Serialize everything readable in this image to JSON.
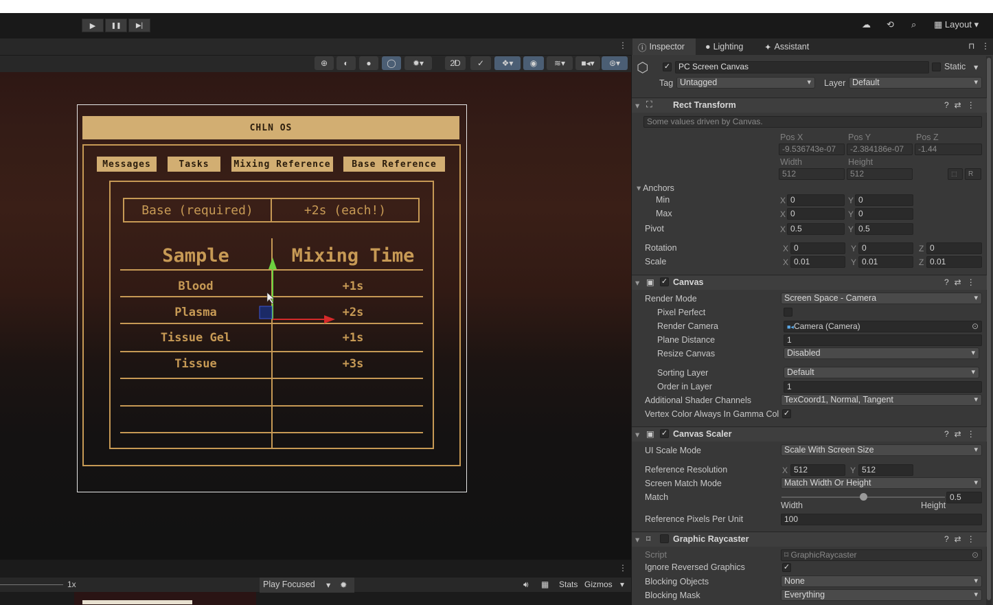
{
  "toolbar": {
    "play_icon": "▶",
    "pause_icon": "❚❚",
    "step_icon": "▶|",
    "layout_label": "Layout"
  },
  "game_view": {
    "scale_label": "1x",
    "play_mode": "Play Focused",
    "stats_label": "Stats",
    "gizmos_label": "Gizmos"
  },
  "os_screen": {
    "title": "CHLN OS",
    "tabs": [
      "Messages",
      "Tasks",
      "Mixing Reference",
      "Base Reference"
    ],
    "header": [
      "Base (required)",
      "+2s (each!)"
    ],
    "columns": [
      "Sample",
      "Mixing Time"
    ],
    "rows": [
      {
        "sample": "Blood",
        "time": "+1s"
      },
      {
        "sample": "Plasma",
        "time": "+2s"
      },
      {
        "sample": "Tissue Gel",
        "time": "+1s"
      },
      {
        "sample": "Tissue",
        "time": "+3s"
      }
    ]
  },
  "inspector": {
    "tabs": {
      "inspector": "Inspector",
      "lighting": "Lighting",
      "assistant": "Assistant"
    },
    "object_name": "PC Screen Canvas",
    "static_label": "Static",
    "tag_label": "Tag",
    "tag_value": "Untagged",
    "layer_label": "Layer",
    "layer_value": "Default",
    "rect_transform": {
      "title": "Rect Transform",
      "note": "Some values driven by Canvas.",
      "pos_x_label": "Pos X",
      "pos_y_label": "Pos Y",
      "pos_z_label": "Pos Z",
      "pos_x": "-9.536743e-07",
      "pos_y": "-2.384186e-07",
      "pos_z": "-1.44",
      "width_label": "Width",
      "height_label": "Height",
      "width": "512",
      "height": "512",
      "anchors_label": "Anchors",
      "min_label": "Min",
      "max_label": "Max",
      "min_x": "0",
      "min_y": "0",
      "max_x": "0",
      "max_y": "0",
      "pivot_label": "Pivot",
      "pivot_x": "0.5",
      "pivot_y": "0.5",
      "rotation_label": "Rotation",
      "rot_x": "0",
      "rot_y": "0",
      "rot_z": "0",
      "scale_label": "Scale",
      "scale_x": "0.01",
      "scale_y": "0.01",
      "scale_z": "0.01",
      "r_button": "R"
    },
    "canvas": {
      "title": "Canvas",
      "render_mode_label": "Render Mode",
      "render_mode": "Screen Space - Camera",
      "pixel_perfect_label": "Pixel Perfect",
      "render_camera_label": "Render Camera",
      "render_camera": "Camera (Camera)",
      "plane_distance_label": "Plane Distance",
      "plane_distance": "1",
      "resize_canvas_label": "Resize Canvas",
      "resize_canvas": "Disabled",
      "sorting_layer_label": "Sorting Layer",
      "sorting_layer": "Default",
      "order_label": "Order in Layer",
      "order": "1",
      "shader_channels_label": "Additional Shader Channels",
      "shader_channels": "TexCoord1, Normal, Tangent",
      "vertex_color_label": "Vertex Color Always In Gamma Col"
    },
    "canvas_scaler": {
      "title": "Canvas Scaler",
      "ui_scale_label": "UI Scale Mode",
      "ui_scale": "Scale With Screen Size",
      "ref_res_label": "Reference Resolution",
      "ref_x": "512",
      "ref_y": "512",
      "match_mode_label": "Screen Match Mode",
      "match_mode": "Match Width Or Height",
      "match_label": "Match",
      "match_value": "0.5",
      "match_fraction": 0.5,
      "width_label": "Width",
      "height_label": "Height",
      "ppu_label": "Reference Pixels Per Unit",
      "ppu": "100"
    },
    "graphic_raycaster": {
      "title": "Graphic Raycaster",
      "script_label": "Script",
      "script": "GraphicRaycaster",
      "ignore_reversed_label": "Ignore Reversed Graphics",
      "blocking_objects_label": "Blocking Objects",
      "blocking_objects": "None",
      "blocking_mask_label": "Blocking Mask",
      "blocking_mask": "Everything"
    }
  }
}
